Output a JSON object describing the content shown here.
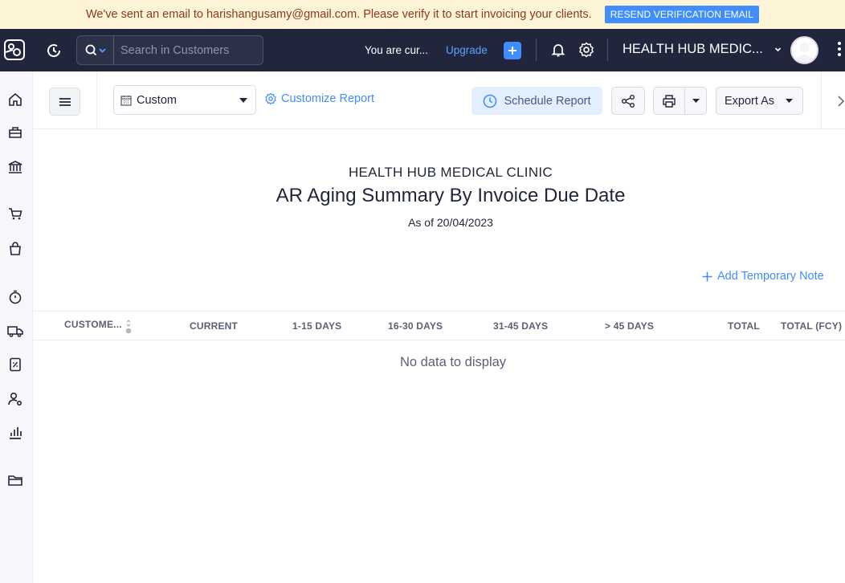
{
  "banner": {
    "message": "We've sent an email to harishangusamy@gmail.com. Please verify it to start invoicing your clients.",
    "button_label": "RESEND VERIFICATION EMAIL"
  },
  "topbar": {
    "search_placeholder": "Search in Customers",
    "trial_text": "You are cur...",
    "upgrade_label": "Upgrade",
    "org_name": "HEALTH HUB MEDIC...",
    "icons": [
      "app-logo-icon",
      "recent-activity-icon",
      "search-icon",
      "chevron-down-icon",
      "plus-icon",
      "bell-icon",
      "gear-icon",
      "avatar",
      "kebab-icon"
    ]
  },
  "sidebar": {
    "items": [
      {
        "name": "home"
      },
      {
        "name": "items"
      },
      {
        "name": "banking"
      },
      {
        "name": "sales"
      },
      {
        "name": "purchases"
      },
      {
        "name": "time-tracking"
      },
      {
        "name": "delivery"
      },
      {
        "name": "tax"
      },
      {
        "name": "accountant"
      },
      {
        "name": "reports"
      },
      {
        "name": "documents"
      }
    ]
  },
  "toolbar": {
    "date_range": "Custom",
    "customize_label": "Customize Report",
    "schedule_label": "Schedule Report",
    "export_label": "Export As"
  },
  "report": {
    "org_name": "HEALTH HUB MEDICAL CLINIC",
    "title": "AR Aging Summary By Invoice Due Date",
    "as_of": "As of 20/04/2023",
    "add_note_label": "Add Temporary Note",
    "columns": [
      "CUSTOME...",
      "CURRENT",
      "1-15 DAYS",
      "16-30 DAYS",
      "31-45 DAYS",
      "> 45 DAYS",
      "TOTAL",
      "TOTAL (FCY)"
    ],
    "empty_message": "No data to display"
  },
  "colors": {
    "accent": "#408dfb",
    "topbar_bg": "#21263c",
    "banner_bg": "#fdf3d7",
    "banner_text": "#8a3b1c"
  }
}
